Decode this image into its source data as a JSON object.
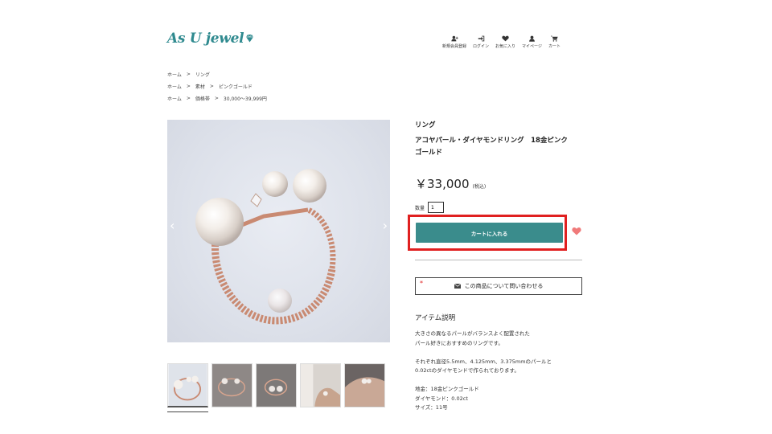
{
  "brand": {
    "logo_text": "As U jewel"
  },
  "header_nav": [
    {
      "label": "新規会員登録",
      "icon": "user-plus-icon"
    },
    {
      "label": "ログイン",
      "icon": "login-icon"
    },
    {
      "label": "お気に入り",
      "icon": "heart-icon"
    },
    {
      "label": "マイページ",
      "icon": "user-icon"
    },
    {
      "label": "カート",
      "icon": "cart-icon"
    }
  ],
  "breadcrumbs": [
    [
      "ホーム",
      "リング"
    ],
    [
      "ホーム",
      "素材",
      "ピンクゴールド"
    ],
    [
      "ホーム",
      "価格帯",
      "30,000〜39,999円"
    ]
  ],
  "breadcrumb_separator": ">",
  "gallery": {
    "prev_arrow": "‹",
    "next_arrow": "›",
    "thumbnail_count": 5
  },
  "product": {
    "category": "リング",
    "name_line1": "アコヤパール・ダイヤモンドリング　18金ピンク",
    "name_line2": "ゴールド",
    "price": "￥33,000",
    "tax_note": "(税込)",
    "quantity_label": "数量",
    "quantity_value": "1",
    "add_to_cart_label": "カートに入れる",
    "inquiry_label": "この商品について問い合わせる",
    "required_mark": "*"
  },
  "description": {
    "title": "アイテム説明",
    "lines_a": [
      "大きさの異なるパールがバランスよく配置された",
      "パール好きにおすすめのリングです。"
    ],
    "lines_b": [
      "それぞれ直径5.5mm、4.125mm、3.375mmのパールと",
      "0.02ctのダイヤモンドで作られております。"
    ],
    "lines_c": [
      "地金：18金ピンクゴールド",
      "ダイヤモンド：0.02ct",
      "サイズ：11号"
    ]
  },
  "colors": {
    "accent_teal": "#3a8c8c",
    "logo_teal": "#2f8a8f",
    "highlight_red": "#e02020",
    "heart_pink": "#f07a7a"
  }
}
